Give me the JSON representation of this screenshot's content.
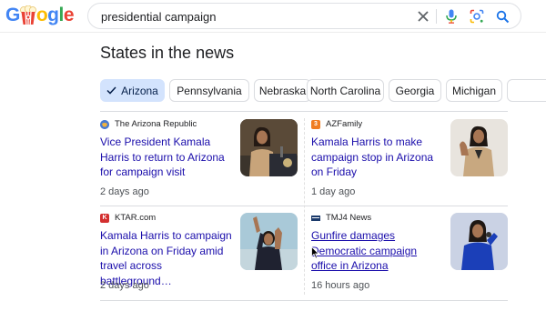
{
  "logo": {
    "letters": [
      "G",
      "g",
      "l",
      "e"
    ],
    "colors": [
      "#4285F4",
      "#EA4335",
      "#FBBC05",
      "#4285F4",
      "#34A853",
      "#EA4335"
    ]
  },
  "search": {
    "value": "presidential campaign",
    "icons": [
      "close-icon",
      "mic-icon",
      "lens-icon",
      "search-icon"
    ]
  },
  "section": {
    "title": "States in the news",
    "chips": [
      {
        "label": "Arizona",
        "selected": true
      },
      {
        "label": "Pennsylvania",
        "selected": false
      },
      {
        "label": "Nebraska",
        "selected": false
      },
      {
        "label": "North Carolina",
        "selected": false
      },
      {
        "label": "Georgia",
        "selected": false
      },
      {
        "label": "Michigan",
        "selected": false
      }
    ]
  },
  "articles": [
    {
      "source": "The Arizona Republic",
      "headline": "Vice President Kamala Harris to return to Arizona for campaign visit",
      "time": "2 days ago",
      "favicon_color": "#4a7bd0"
    },
    {
      "source": "AZFamily",
      "headline": "Kamala Harris to make campaign stop in Arizona on Friday",
      "time": "1 day ago",
      "favicon_color": "#f07d22"
    },
    {
      "source": "KTAR.com",
      "headline": "Kamala Harris to campaign in Arizona on Friday amid travel across battleground…",
      "time": "2 days ago",
      "favicon_color": "#d32f2f"
    },
    {
      "source": "TMJ4 News",
      "headline": "Gunfire damages Democratic campaign office in Arizona",
      "time": "16 hours ago",
      "favicon_color": "#1b3a6b"
    }
  ]
}
